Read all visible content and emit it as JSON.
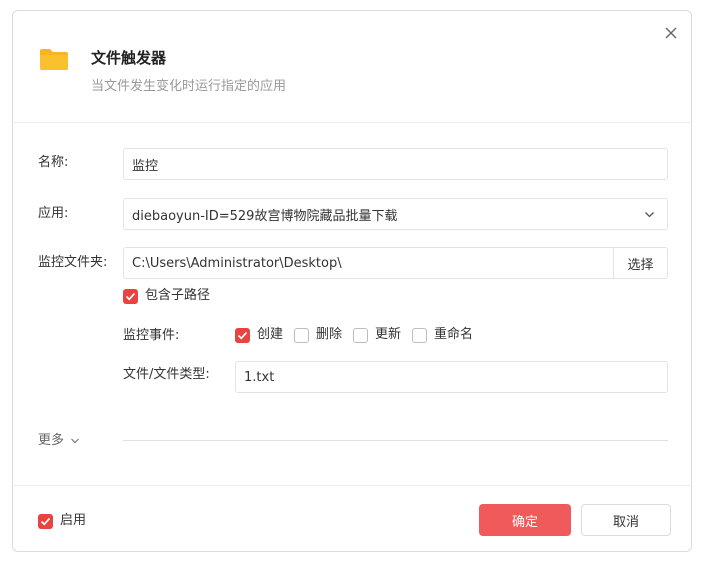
{
  "dialog": {
    "title": "文件触发器",
    "subtitle": "当文件发生变化时运行指定的应用",
    "icons": {
      "header": "folder-icon",
      "close": "close-icon"
    }
  },
  "form": {
    "name": {
      "label": "名称:",
      "value": "监控"
    },
    "app": {
      "label": "应用:",
      "value": "diebaoyun-ID=529故宫博物院藏品批量下载",
      "icon": "chevron-down-icon"
    },
    "folder": {
      "label": "监控文件夹:",
      "value": "C:\\Users\\Administrator\\Desktop\\",
      "button": "选择"
    },
    "include_subpaths": {
      "label": "包含子路径",
      "checked": true
    },
    "events": {
      "label": "监控事件:",
      "options": [
        {
          "label": "创建",
          "checked": true
        },
        {
          "label": "删除",
          "checked": false
        },
        {
          "label": "更新",
          "checked": false
        },
        {
          "label": "重命名",
          "checked": false
        }
      ]
    },
    "file_type": {
      "label": "文件/文件类型:",
      "value": "1.txt"
    },
    "more": {
      "label": "更多",
      "icon": "chevron-down-icon"
    }
  },
  "footer": {
    "enable": {
      "label": "启用",
      "checked": true
    },
    "confirm": "确定",
    "cancel": "取消"
  },
  "colors": {
    "accent": "#e8433f",
    "primary_button": "#f05a5a",
    "folder": "#f8b51f"
  }
}
